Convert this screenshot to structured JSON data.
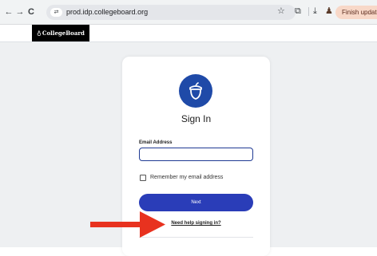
{
  "browser": {
    "back_icon": "←",
    "forward_icon": "→",
    "reload_icon": "C",
    "site_info_icon": "⇄",
    "url": "prod.idp.collegeboard.org",
    "star_icon": "☆",
    "extensions_icon": "⧉",
    "download_icon": "⤓",
    "profile_icon": "♟",
    "finish_update_label": "Finish update"
  },
  "header": {
    "logo_text": "CollegeBoard",
    "logo_symbol": "♁"
  },
  "signin": {
    "title": "Sign In",
    "email_label": "Email Address",
    "email_value": "",
    "remember_label": "Remember my email address",
    "next_label": "Next",
    "help_link": "Need help signing in?"
  },
  "colors": {
    "brand_blue": "#1f4aa8",
    "button_blue": "#2a3db8",
    "arrow_red": "#e8321f"
  }
}
